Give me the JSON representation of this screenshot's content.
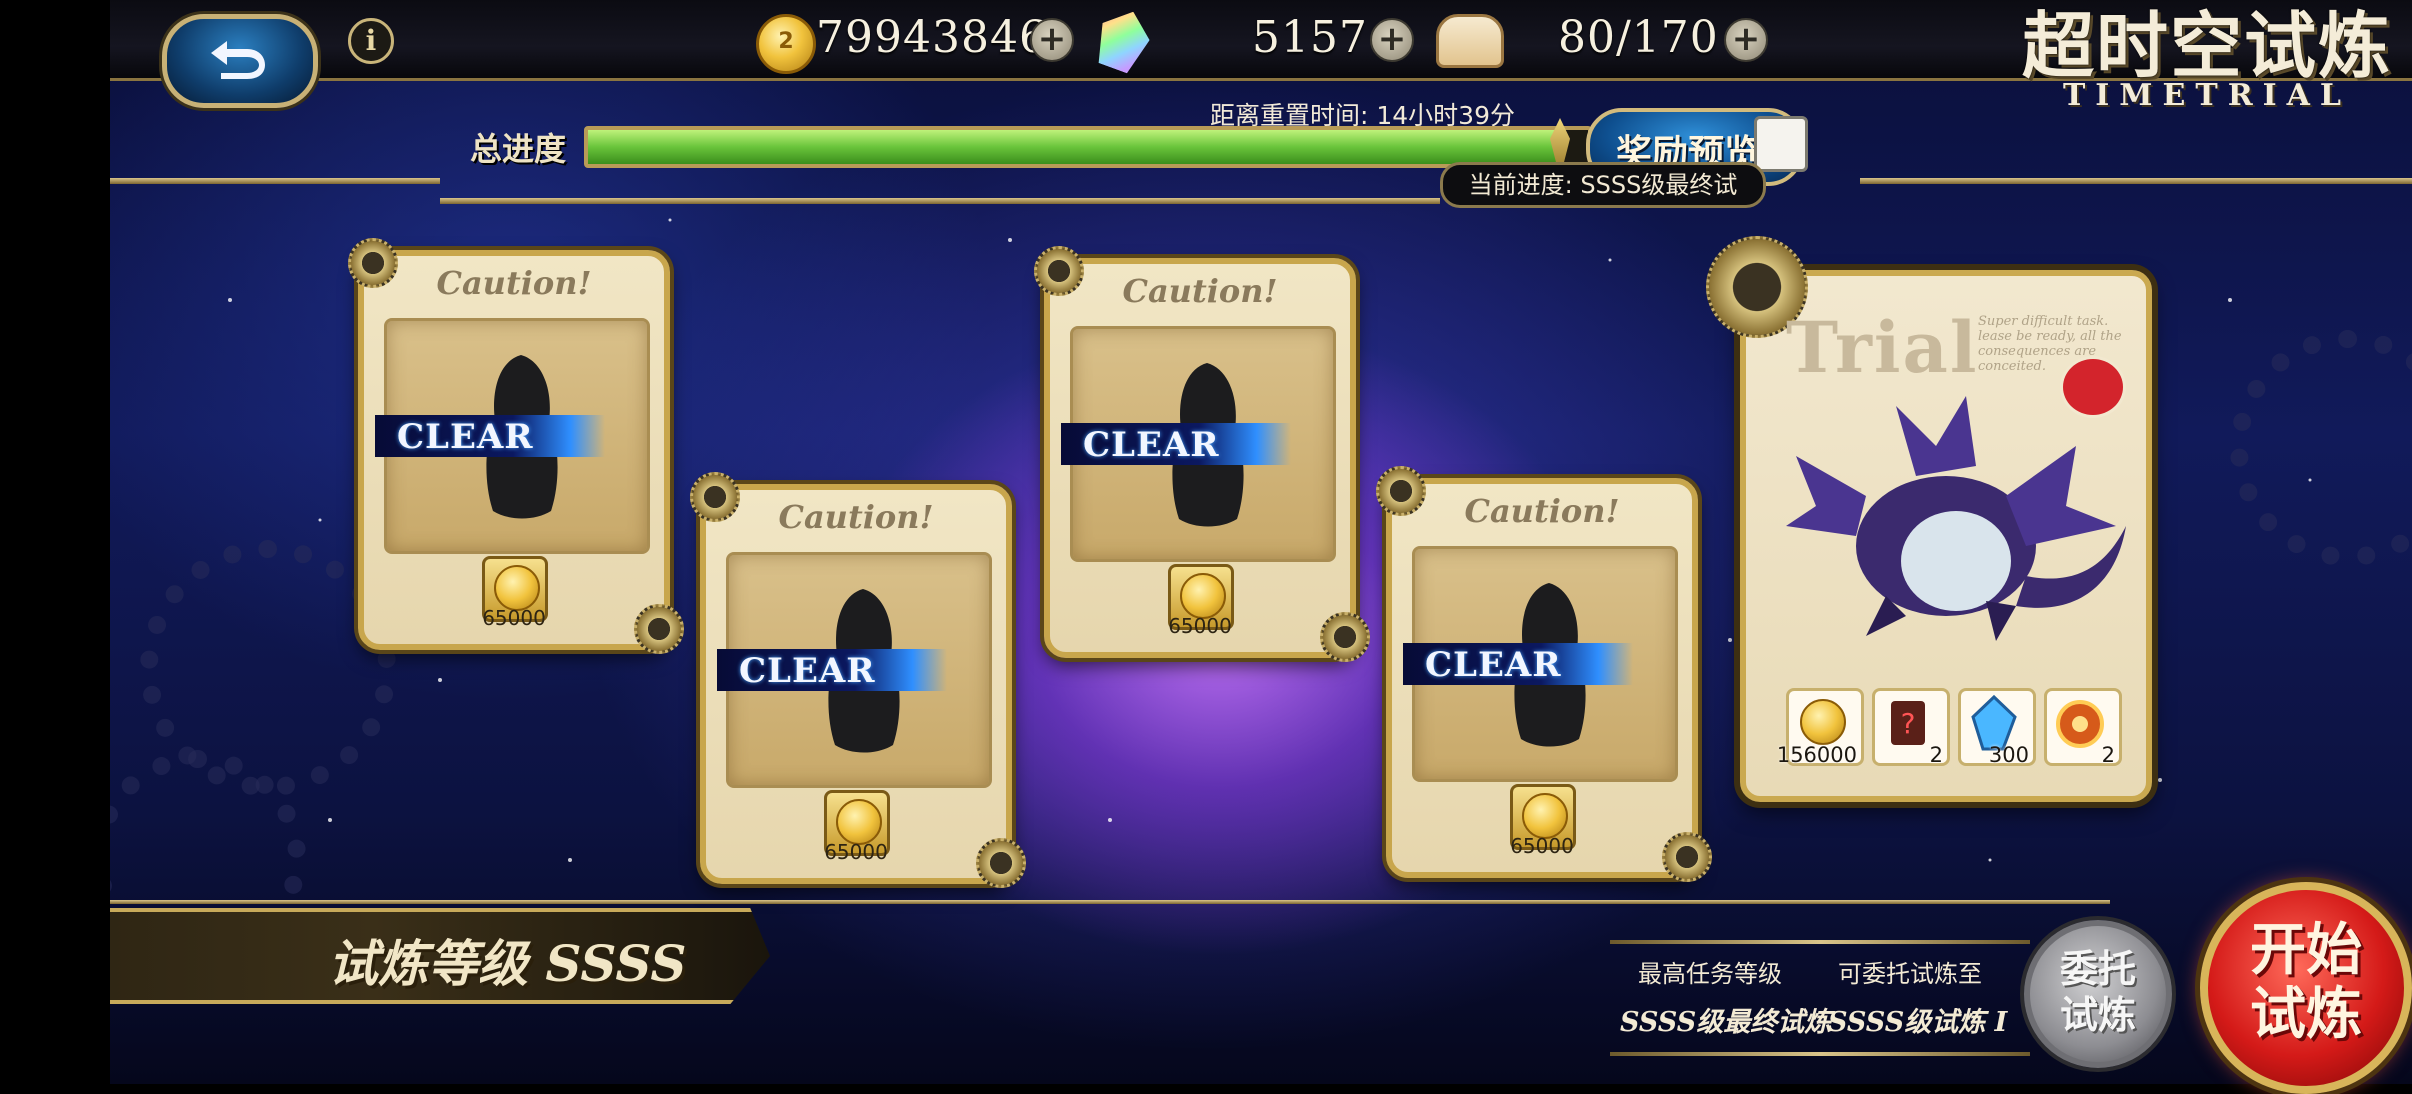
{
  "header": {
    "coins": "79943846",
    "crystals": "5157",
    "stamina": "80/170",
    "coin_icon_glyph": "2",
    "info_glyph": "i"
  },
  "logo": {
    "title_cn": "超时空试炼",
    "title_en": "TIMETRIAL"
  },
  "progress": {
    "label": "总进度",
    "reset_time": "距离重置时间: 14小时39分",
    "reward_preview_label": "奖励预览",
    "current_progress": "当前进度: SSSS级最终试",
    "fill_fraction": 0.97
  },
  "cards": [
    {
      "title": "Caution!",
      "status": "CLEAR",
      "reward": "65000"
    },
    {
      "title": "Caution!",
      "status": "CLEAR",
      "reward": "65000"
    },
    {
      "title": "Caution!",
      "status": "CLEAR",
      "reward": "65000"
    },
    {
      "title": "Caution!",
      "status": "CLEAR",
      "reward": "65000"
    }
  ],
  "boss": {
    "title": "Trial",
    "note": "Super difficult task. lease be ready, all the consequences are conceited.",
    "rewards": [
      {
        "icon": "gold-coin-icon",
        "value": "156000"
      },
      {
        "icon": "scroll-icon",
        "value": "2"
      },
      {
        "icon": "crystal-shard-icon",
        "value": "300"
      },
      {
        "icon": "emblem-icon",
        "value": "2"
      }
    ]
  },
  "bottom": {
    "trial_grade": "试炼等级 SSSS",
    "highest_task_label": "最高任务等级",
    "delegate_limit_label": "可委托试炼至",
    "highest_task_value": "SSSS级最终试炼",
    "delegate_limit_value": "SSSS级试炼 I",
    "delegate_button": "委托试炼",
    "start_button": "开始试炼"
  },
  "colors": {
    "accent_gold": "#c8a64c",
    "progress_green": "#69c43b",
    "start_red": "#d41a18"
  }
}
